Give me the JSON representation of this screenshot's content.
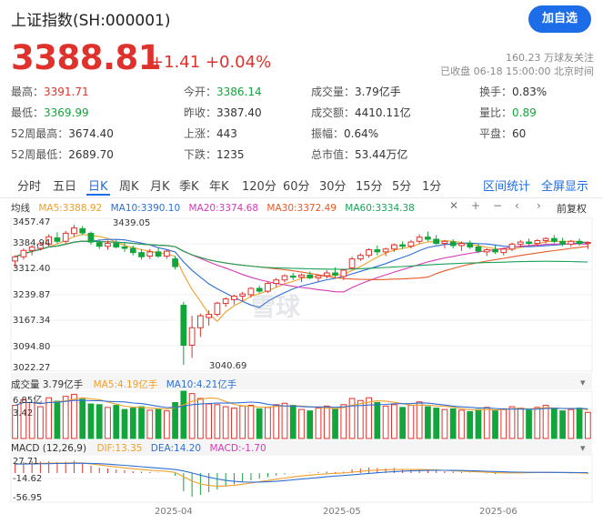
{
  "header": {
    "title": "上证指数(SH:000001)",
    "follow_button": "加自选",
    "price": "3388.81",
    "change": "+1.41",
    "change_pct": "+0.04%",
    "followers": "160.23 万球友关注",
    "status": "已收盘 06-18 15:00:00 北京时间"
  },
  "stats": {
    "high_label": "最高：",
    "high": "3391.71",
    "low_label": "最低：",
    "low": "3369.99",
    "w52_high_label": "52周最高：",
    "w52_high": "3674.40",
    "w52_low_label": "52周最低：",
    "w52_low": "2689.70",
    "open_label": "今开：",
    "open": "3386.14",
    "prev_close_label": "昨收：",
    "prev_close": "3387.40",
    "up_label": "上涨：",
    "up": "443",
    "down_label": "下跌：",
    "down": "1235",
    "volume_label": "成交量：",
    "volume": "3.79亿手",
    "amount_label": "成交额：",
    "amount": "4410.11亿",
    "amplitude_label": "振幅：",
    "amplitude": "0.64%",
    "mkt_cap_label": "总市值：",
    "mkt_cap": "53.44万亿",
    "turnover_label": "换手：",
    "turnover": "0.83%",
    "vol_ratio_label": "量比：",
    "vol_ratio": "0.89",
    "flat_label": "平盘：",
    "flat": "60"
  },
  "tabs": [
    "分时",
    "五日",
    "日K",
    "周K",
    "月K",
    "季K",
    "年K",
    "120分",
    "60分",
    "30分",
    "15分",
    "5分",
    "1分"
  ],
  "active_tab": "日K",
  "tab_links": {
    "interval_stats": "区间统计",
    "fullscreen": "全屏显示"
  },
  "ma": {
    "label": "均线",
    "ma5": "MA5:3388.92",
    "ma10": "MA10:3390.10",
    "ma20": "MA20:3374.68",
    "ma30": "MA30:3372.49",
    "ma60": "MA60:3334.38"
  },
  "adjust": "前复权",
  "colors": {
    "up": "#e0322c",
    "down": "#12a53b",
    "ma5": "#f0a02a",
    "ma10": "#2f6fd6",
    "ma20": "#d63ab7",
    "ma30": "#e65a2a",
    "ma60": "#1aa35a",
    "accent": "#1d6ce8"
  },
  "price_axis": [
    "3457.47",
    "3384.94",
    "3312.40",
    "3239.87",
    "3167.34",
    "3094.80",
    "3022.27"
  ],
  "annotations": {
    "high": "3439.05",
    "low": "3040.69"
  },
  "volume_panel": {
    "label": "成交量 3.79亿手",
    "ma5": "MA5:4.19亿手",
    "ma10": "MA10:4.21亿手",
    "axis_top": "6.85亿",
    "axis_mid": "3.42"
  },
  "macd_panel": {
    "label": "MACD (12,26,9)",
    "dif": "DIF:13.35",
    "dea": "DEA:14.20",
    "macd": "MACD:-1.70",
    "axis": [
      "27.71",
      "-14.62",
      "-56.95"
    ]
  },
  "x_axis": [
    "2025-04",
    "2025-05",
    "2025-06"
  ],
  "watermark": "雪球",
  "chart_data": {
    "type": "candlestick",
    "dates_shown": [
      "2025-04",
      "2025-05",
      "2025-06"
    ],
    "ylim": [
      3022.27,
      3457.47
    ],
    "candles": [
      [
        3336,
        3352,
        3318,
        3348
      ],
      [
        3348,
        3372,
        3340,
        3366
      ],
      [
        3366,
        3381,
        3352,
        3376
      ],
      [
        3372,
        3390,
        3366,
        3385
      ],
      [
        3384,
        3412,
        3378,
        3405
      ],
      [
        3402,
        3418,
        3386,
        3392
      ],
      [
        3392,
        3422,
        3385,
        3415
      ],
      [
        3414,
        3439,
        3405,
        3430
      ],
      [
        3428,
        3436,
        3410,
        3416
      ],
      [
        3415,
        3420,
        3382,
        3390
      ],
      [
        3388,
        3398,
        3370,
        3378
      ],
      [
        3378,
        3394,
        3368,
        3386
      ],
      [
        3386,
        3398,
        3372,
        3376
      ],
      [
        3376,
        3386,
        3362,
        3372
      ],
      [
        3372,
        3380,
        3352,
        3360
      ],
      [
        3360,
        3370,
        3340,
        3348
      ],
      [
        3350,
        3370,
        3342,
        3362
      ],
      [
        3362,
        3372,
        3345,
        3350
      ],
      [
        3350,
        3368,
        3342,
        3364
      ],
      [
        3342,
        3350,
        3312,
        3320
      ],
      [
        3210,
        3220,
        3040,
        3096
      ],
      [
        3096,
        3180,
        3060,
        3146
      ],
      [
        3146,
        3186,
        3120,
        3180
      ],
      [
        3175,
        3196,
        3152,
        3184
      ],
      [
        3184,
        3220,
        3178,
        3216
      ],
      [
        3215,
        3232,
        3205,
        3228
      ],
      [
        3226,
        3240,
        3212,
        3236
      ],
      [
        3236,
        3248,
        3222,
        3242
      ],
      [
        3240,
        3262,
        3232,
        3258
      ],
      [
        3258,
        3266,
        3244,
        3250
      ],
      [
        3250,
        3276,
        3245,
        3272
      ],
      [
        3272,
        3288,
        3262,
        3282
      ],
      [
        3282,
        3298,
        3275,
        3294
      ],
      [
        3293,
        3302,
        3282,
        3290
      ],
      [
        3290,
        3300,
        3276,
        3296
      ],
      [
        3296,
        3306,
        3284,
        3288
      ],
      [
        3288,
        3298,
        3278,
        3294
      ],
      [
        3294,
        3310,
        3286,
        3302
      ],
      [
        3302,
        3318,
        3290,
        3296
      ],
      [
        3292,
        3312,
        3282,
        3310
      ],
      [
        3316,
        3348,
        3312,
        3342
      ],
      [
        3342,
        3358,
        3336,
        3352
      ],
      [
        3352,
        3372,
        3345,
        3368
      ],
      [
        3368,
        3380,
        3352,
        3362
      ],
      [
        3362,
        3374,
        3350,
        3370
      ],
      [
        3370,
        3386,
        3362,
        3382
      ],
      [
        3382,
        3392,
        3370,
        3378
      ],
      [
        3378,
        3396,
        3372,
        3390
      ],
      [
        3392,
        3412,
        3385,
        3404
      ],
      [
        3404,
        3420,
        3392,
        3398
      ],
      [
        3398,
        3410,
        3382,
        3386
      ],
      [
        3386,
        3396,
        3372,
        3392
      ],
      [
        3390,
        3398,
        3372,
        3380
      ],
      [
        3380,
        3392,
        3365,
        3386
      ],
      [
        3386,
        3394,
        3370,
        3376
      ],
      [
        3376,
        3386,
        3358,
        3364
      ],
      [
        3362,
        3372,
        3350,
        3368
      ],
      [
        3368,
        3380,
        3356,
        3362
      ],
      [
        3360,
        3374,
        3352,
        3370
      ],
      [
        3370,
        3388,
        3364,
        3384
      ],
      [
        3384,
        3396,
        3376,
        3390
      ],
      [
        3390,
        3400,
        3380,
        3386
      ],
      [
        3386,
        3398,
        3378,
        3394
      ],
      [
        3394,
        3404,
        3386,
        3400
      ],
      [
        3400,
        3410,
        3386,
        3392
      ],
      [
        3392,
        3402,
        3378,
        3384
      ],
      [
        3384,
        3396,
        3376,
        3392
      ],
      [
        3392,
        3400,
        3380,
        3386
      ],
      [
        3386,
        3391.71,
        3369.99,
        3388.81
      ]
    ],
    "volume": [
      4.8,
      5.6,
      5.2,
      4.6,
      5.9,
      5.4,
      6.1,
      6.4,
      5.7,
      5.0,
      4.9,
      4.5,
      4.8,
      4.2,
      4.4,
      4.6,
      4.1,
      4.3,
      4.0,
      5.2,
      6.85,
      6.5,
      5.8,
      5.0,
      4.9,
      4.6,
      4.4,
      4.7,
      4.8,
      4.3,
      4.5,
      4.9,
      5.1,
      4.8,
      4.2,
      4.0,
      4.4,
      4.7,
      4.3,
      4.9,
      5.8,
      5.5,
      5.9,
      5.2,
      4.7,
      4.9,
      4.5,
      4.8,
      5.3,
      4.6,
      4.4,
      4.2,
      4.3,
      4.1,
      3.9,
      4.2,
      4.5,
      4.0,
      4.3,
      4.6,
      4.4,
      4.1,
      4.5,
      4.8,
      4.3,
      4.0,
      4.2,
      4.4,
      3.79
    ],
    "macd": [
      22,
      24,
      26,
      25,
      26,
      24,
      25,
      27,
      22,
      16,
      12,
      10,
      8,
      6,
      4,
      3,
      2,
      1,
      0,
      -6,
      -40,
      -52,
      -48,
      -42,
      -36,
      -30,
      -25,
      -20,
      -16,
      -12,
      -9,
      -6,
      -3,
      -1,
      0,
      1,
      2,
      3,
      2,
      3,
      8,
      10,
      12,
      11,
      10,
      11,
      9,
      8,
      9,
      7,
      5,
      4,
      3,
      2,
      1,
      0,
      -1,
      -2,
      -1,
      0,
      1,
      2,
      2,
      3,
      1,
      0,
      -1,
      -1,
      -1.7
    ]
  }
}
